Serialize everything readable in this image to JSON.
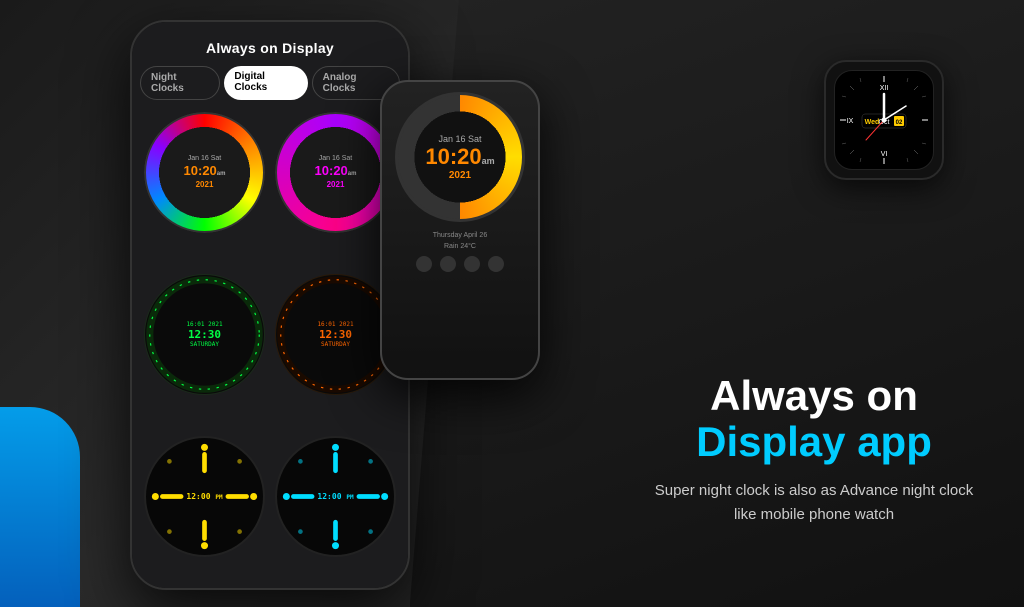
{
  "app": {
    "title": "Always on Display app",
    "headline_line1": "Always on",
    "headline_line2": "Display app",
    "subtitle": "Super night clock is also as Advance night clock like mobile phone watch"
  },
  "phone": {
    "screen_title": "Always on Display",
    "tabs": [
      {
        "label": "Night Clocks",
        "active": false
      },
      {
        "label": "Digital Clocks",
        "active": true
      },
      {
        "label": "Analog Clocks",
        "active": false
      }
    ]
  },
  "clocks": {
    "row1": [
      {
        "date": "Jan 16 Sat",
        "time": "10:20",
        "ampm": "am",
        "year": "2021",
        "style": "rainbow"
      },
      {
        "date": "Jan 16 Sat",
        "time": "10:20",
        "ampm": "am",
        "year": "2021",
        "style": "purple"
      }
    ],
    "row2": [
      {
        "date": "16:01 2021",
        "day": "SATURDAY",
        "time": "12:30",
        "style": "digital-green"
      },
      {
        "date": "16:01 2021",
        "day": "SATURDAY",
        "time": "12:30",
        "style": "digital-orange"
      }
    ],
    "row3": [
      {
        "time": "12:00",
        "ampm": "PM",
        "style": "minimal-yellow"
      },
      {
        "time": "12:00",
        "ampm": "PM",
        "style": "minimal-cyan"
      }
    ]
  },
  "featured_clock": {
    "date": "Jan 16 Sat",
    "time": "10:20",
    "ampm": "am",
    "year": "2021",
    "weather_day": "Thursday April 26",
    "weather_info": "Rain 24°C"
  },
  "watch": {
    "day": "Wed",
    "month": "Oct",
    "date": "02"
  },
  "colors": {
    "background": "#1a1a1a",
    "accent_cyan": "#00ccff",
    "accent_blue": "#0088ff",
    "rainbow_time": "#ff8800",
    "purple_time": "#ff00ff",
    "green_time": "#00ff44",
    "yellow_dots": "#ffdd00",
    "cyan_dots": "#00ddff"
  }
}
